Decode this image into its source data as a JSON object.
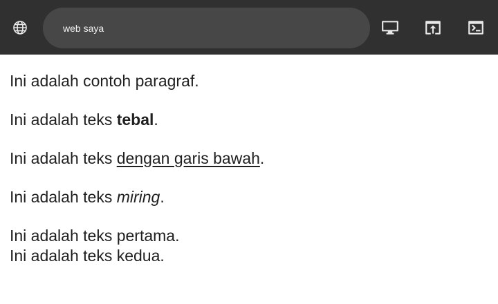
{
  "toolbar": {
    "address": "web saya",
    "icons": {
      "left": "globe-icon",
      "right": [
        "desktop-icon",
        "open-in-new-icon",
        "terminal-icon"
      ]
    },
    "background_color": "#303030",
    "address_bar_color": "#474747"
  },
  "content": {
    "p1": "Ini adalah contoh paragraf.",
    "p2_prefix": "Ini adalah teks ",
    "p2_bold": "tebal",
    "p2_suffix": ".",
    "p3_prefix": "Ini adalah teks ",
    "p3_underline": "dengan garis bawah",
    "p3_suffix": ".",
    "p4_prefix": "Ini adalah teks ",
    "p4_italic": "miring",
    "p4_suffix": ".",
    "line1": "Ini adalah teks pertama.",
    "line2": "Ini adalah teks kedua."
  }
}
